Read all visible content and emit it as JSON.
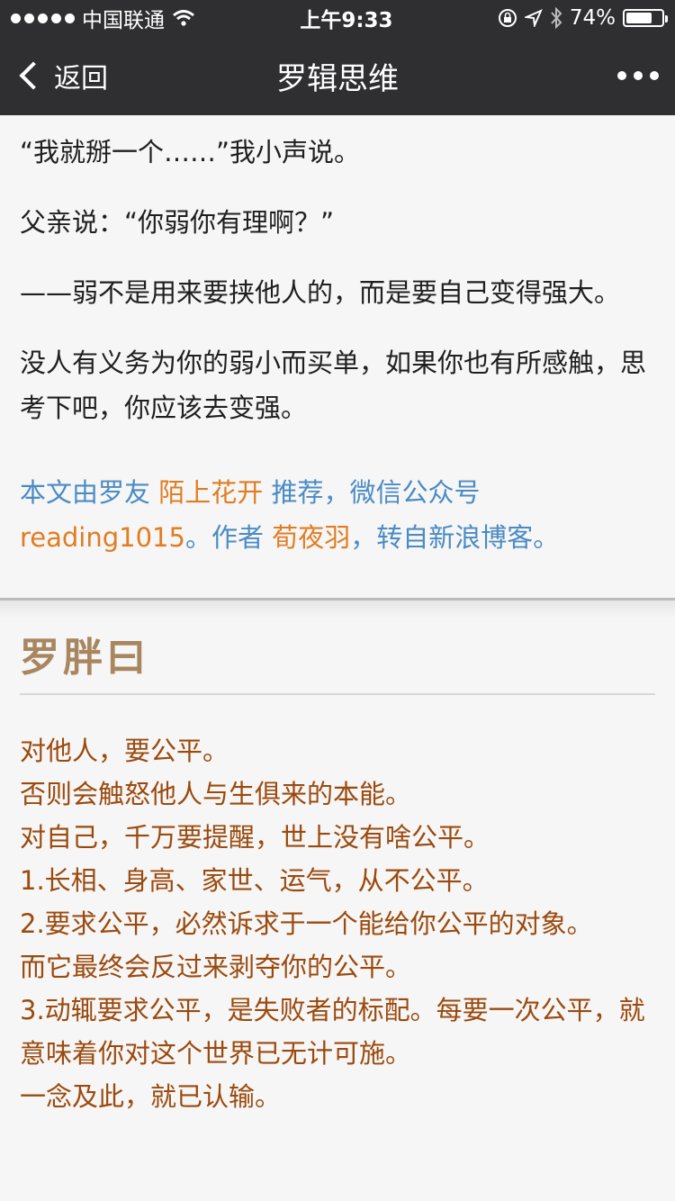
{
  "status": {
    "carrier": "中国联通",
    "time": "上午9:33",
    "battery": "74%",
    "battery_level": 0.74
  },
  "nav": {
    "back_label": "返回",
    "title": "罗辑思维"
  },
  "article": {
    "paragraphs": [
      "“我就掰一个……”我小声说。",
      "父亲说：“你弱你有理啊？”",
      "——弱不是用来要挟他人的，而是要自己变得强大。",
      "没人有义务为你的弱小而买单，如果你也有所感触，思考下吧，你应该去变强。"
    ],
    "credit": {
      "part1": "本文由罗友 ",
      "name1": "陌上花开",
      "part2": " 推荐，微信公众号",
      "handle": "reading1015",
      "part3": "。作者 ",
      "name2": "荀夜羽",
      "part4": "，转自新浪博客。"
    }
  },
  "section": {
    "title": "罗胖曰",
    "lines": [
      "对他人，要公平。",
      "否则会触怒他人与生俱来的本能。",
      "对自己，千万要提醒，世上没有啥公平。",
      "1.长相、身高、家世、运气，从不公平。",
      "2.要求公平，必然诉求于一个能给你公平的对象。",
      "而它最终会反过来剥夺你的公平。",
      "3.动辄要求公平，是失败者的标配。每要一次公平，就意味着你对这个世界已无计可施。",
      "一念及此，就已认输。"
    ]
  },
  "colors": {
    "bar": "#2f2f31",
    "link_blue": "#4b8bc4",
    "name_orange": "#e07d22",
    "quote_brown": "#9b4a0e",
    "title_tan": "#a8865f"
  },
  "icons": {
    "wifi": "wifi-icon",
    "lock": "rotation-lock-icon",
    "location": "location-arrow-icon",
    "bluetooth": "bluetooth-icon",
    "battery": "battery-icon",
    "back": "chevron-left-icon",
    "more": "more-dots-icon"
  }
}
